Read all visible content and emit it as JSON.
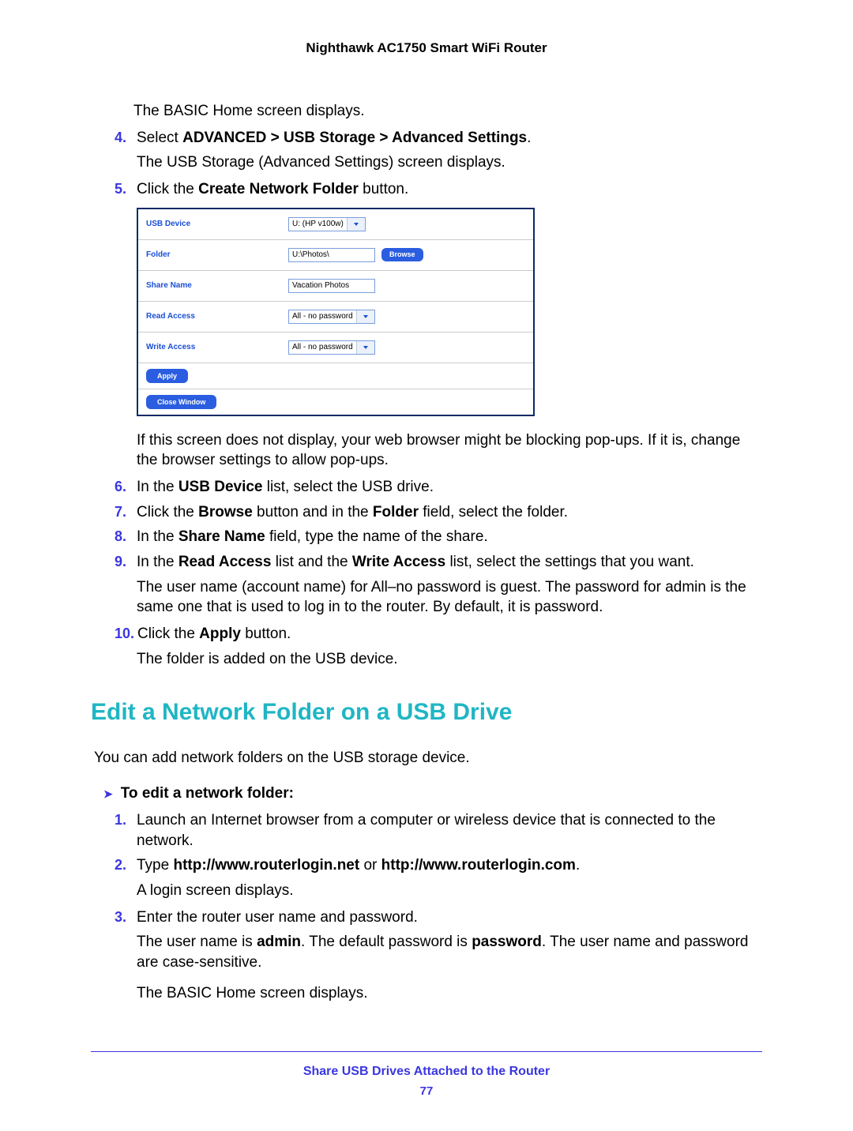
{
  "header": "Nighthawk AC1750 Smart WiFi Router",
  "intro": "The BASIC Home screen displays.",
  "step4": {
    "num": "4.",
    "pre": "Select ",
    "bold": "ADVANCED > USB Storage > Advanced Settings",
    "post": "."
  },
  "p4a": "The USB Storage (Advanced Settings) screen displays.",
  "step5": {
    "num": "5.",
    "pre": "Click the ",
    "bold": "Create Network Folder",
    "post": " button."
  },
  "dlg": {
    "rows": [
      {
        "label": "USB Device",
        "type": "select",
        "value": "U: (HP v100w)"
      },
      {
        "label": "Folder",
        "type": "inputbtn",
        "value": "U:\\Photos\\",
        "btn": "Browse"
      },
      {
        "label": "Share Name",
        "type": "input",
        "value": "Vacation Photos"
      },
      {
        "label": "Read Access",
        "type": "select",
        "value": "All - no password"
      },
      {
        "label": "Write Access",
        "type": "select",
        "value": "All - no password"
      }
    ],
    "apply": "Apply",
    "close": "Close Window"
  },
  "p5a": "If this screen does not display, your web browser might be blocking pop-ups. If it is, change the browser settings to allow pop-ups.",
  "step6": {
    "num": "6.",
    "pre": "In the ",
    "bold": "USB Device",
    "post": " list, select the USB drive."
  },
  "step7": {
    "num": "7.",
    "pre": "Click the ",
    "b1": "Browse",
    "mid": " button and in the ",
    "b2": "Folder",
    "post": " field, select the folder."
  },
  "step8": {
    "num": "8.",
    "pre": "In the ",
    "bold": "Share Name",
    "post": " field, type the name of the share."
  },
  "step9": {
    "num": "9.",
    "pre": "In the ",
    "b1": "Read Access",
    "mid": " list and the ",
    "b2": "Write Access",
    "post": " list, select the settings that you want."
  },
  "p9a": "The user name (account name) for All–no password is guest. The password for admin is the same one that is used to log in to the router. By default, it is password.",
  "step10": {
    "num": "10.",
    "pre": "Click the ",
    "bold": "Apply",
    "post": " button."
  },
  "p10a": "The folder is added on the USB device.",
  "heading": "Edit a Network Folder on a USB Drive",
  "h_p": "You can add network folders on the USB storage device.",
  "arrow": {
    "sym": "➤",
    "txt": "To edit a network folder:"
  },
  "e1": {
    "num": "1.",
    "txt": "Launch an Internet browser from a computer or wireless device that is connected to the network."
  },
  "e2": {
    "num": "2.",
    "pre": "Type ",
    "b1": "http://www.routerlogin.net",
    "mid": " or ",
    "b2": "http://www.routerlogin.com",
    "post": "."
  },
  "e2a": "A login screen displays.",
  "e3": {
    "num": "3.",
    "txt": "Enter the router user name and password."
  },
  "e3a": {
    "pre": "The user name is ",
    "b1": "admin",
    "mid": ". The default password is ",
    "b2": "password",
    "post": ". The user name and password are case-sensitive."
  },
  "e3b": "The BASIC Home screen displays.",
  "footer1": "Share USB Drives Attached to the Router",
  "footer2": "77"
}
